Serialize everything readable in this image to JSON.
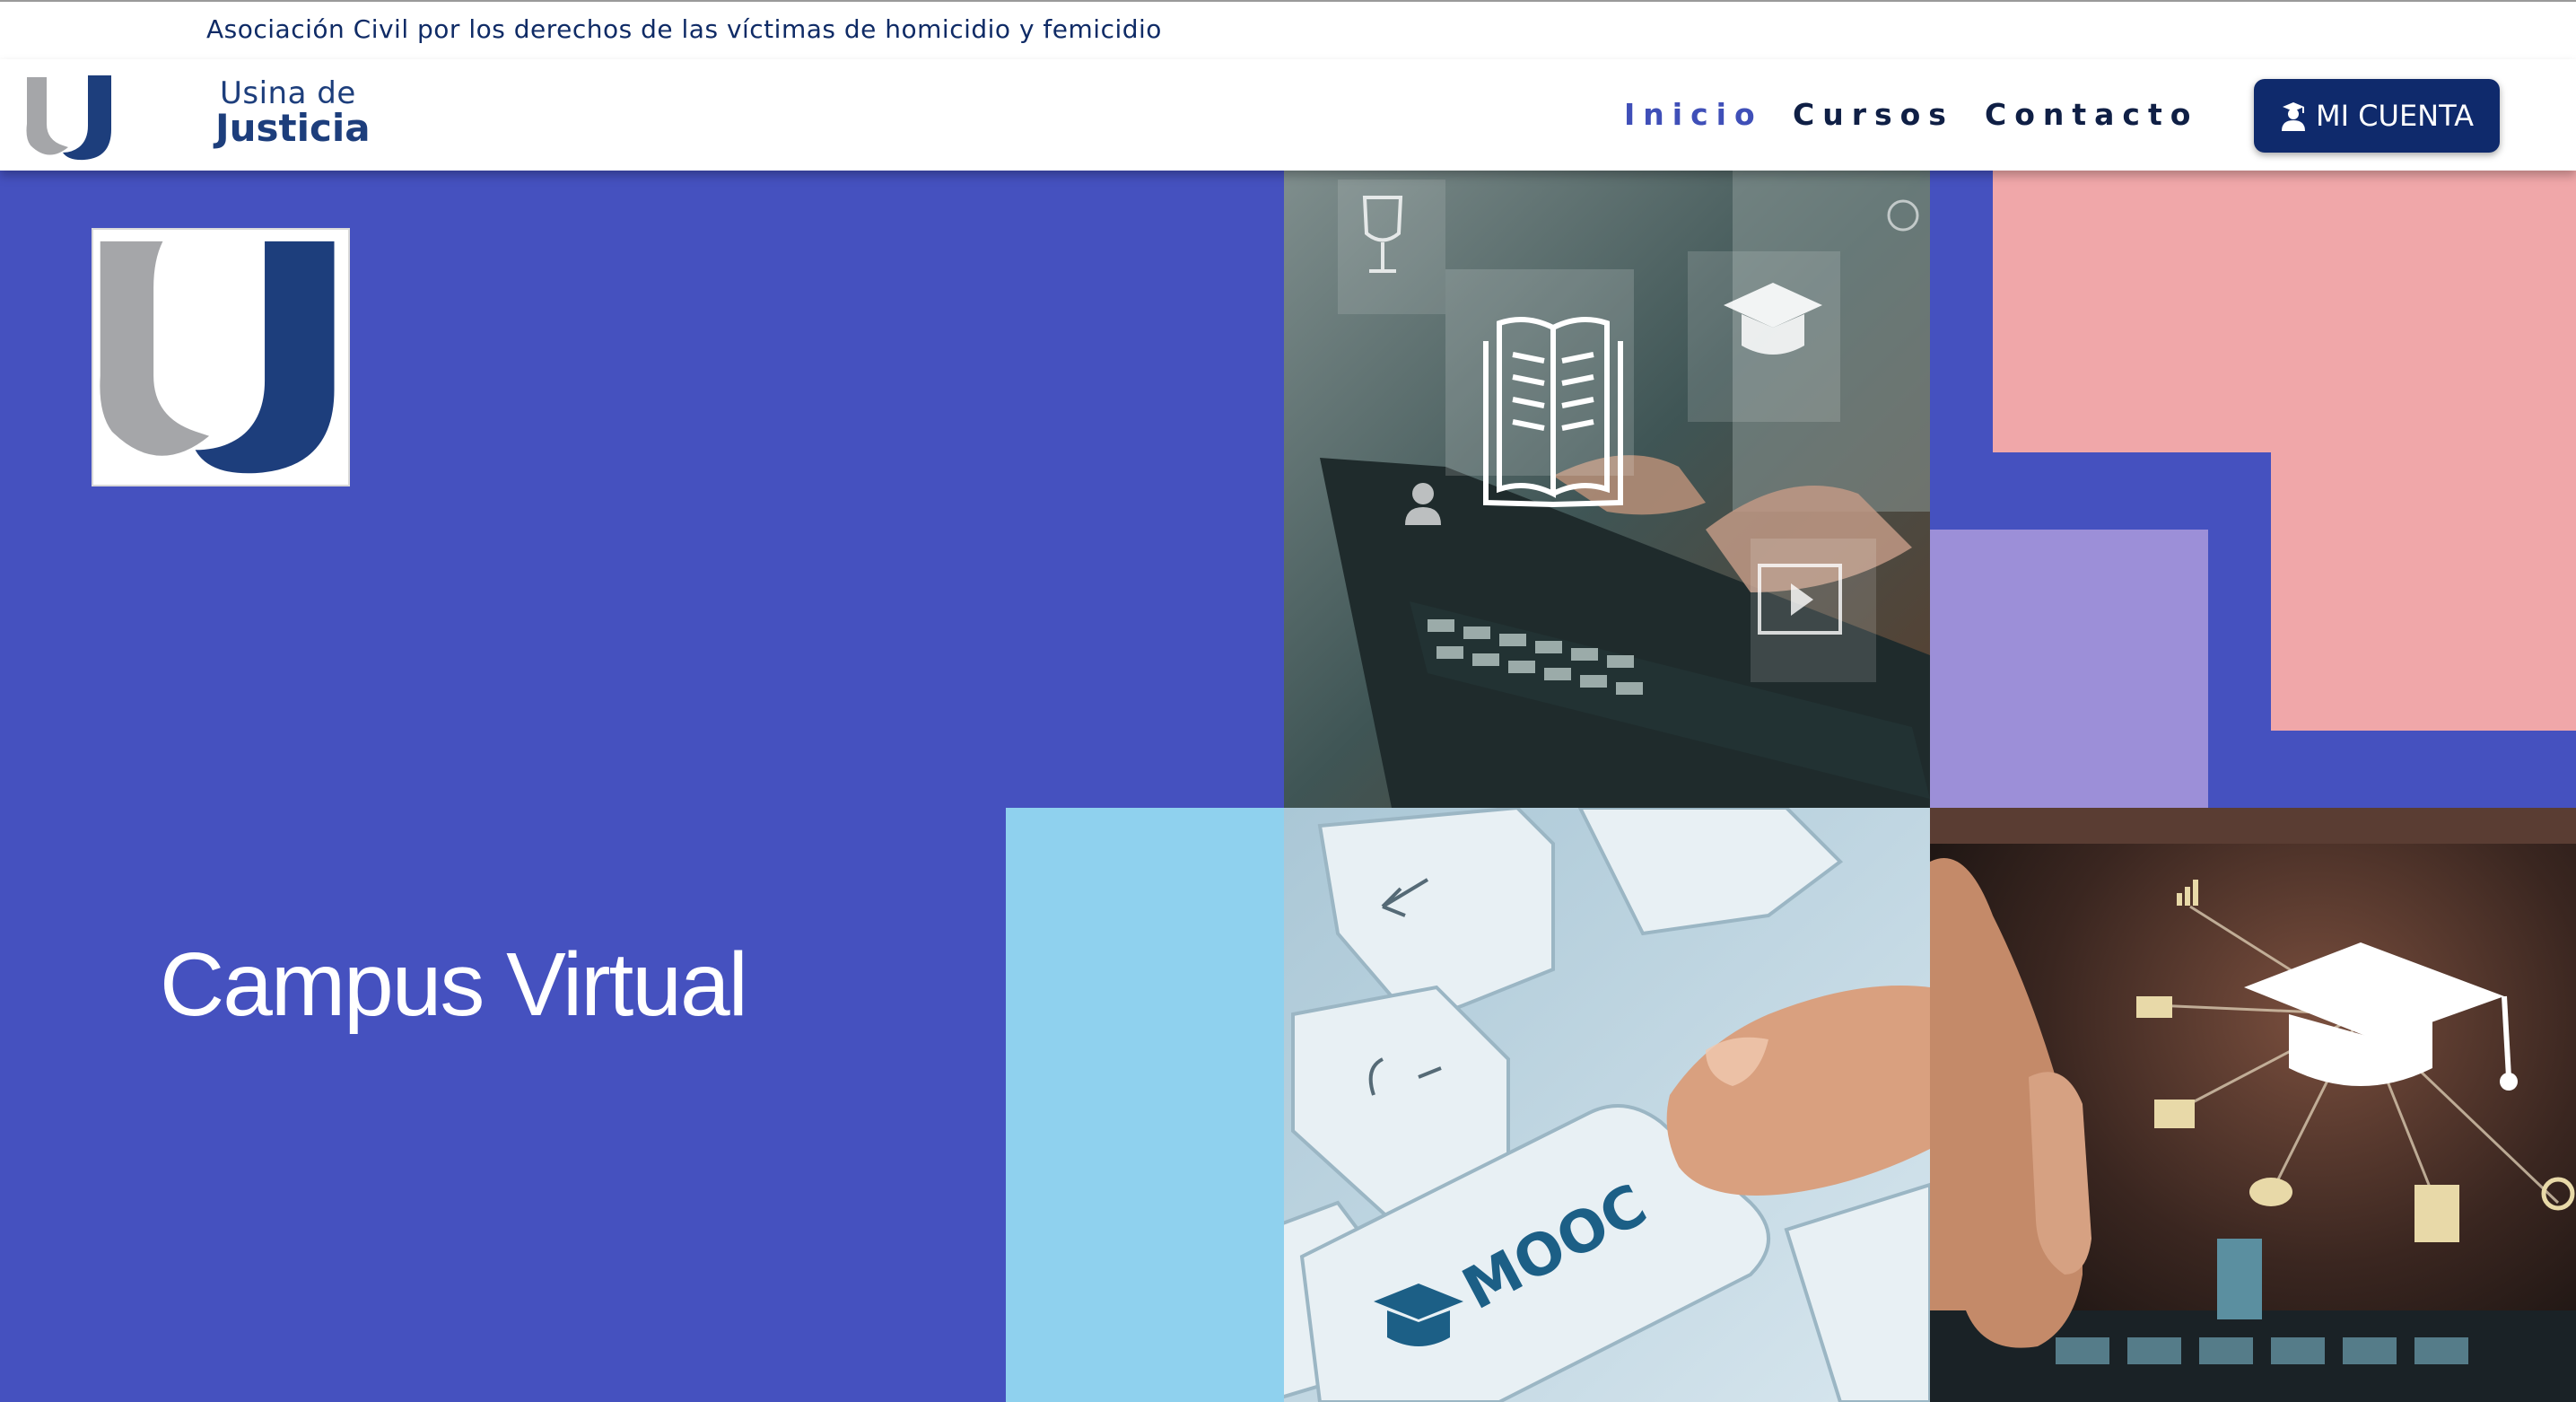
{
  "topbar": {
    "tagline": "Asociación Civil por los derechos de las víctimas de homicidio y femicidio"
  },
  "brand": {
    "line1": "Usina de",
    "line2": "Justicia"
  },
  "nav": {
    "items": [
      {
        "label": "Inicio",
        "active": true
      },
      {
        "label": "Cursos",
        "active": false
      },
      {
        "label": "Contacto",
        "active": false
      }
    ],
    "account_label": "MI CUENTA",
    "account_icon": "student-graduate-icon"
  },
  "hero": {
    "title": "Campus Virtual",
    "images": [
      {
        "name": "laptop-learning-icons-photo"
      },
      {
        "name": "mooc-keyboard-photo",
        "key_text": "MOOC"
      },
      {
        "name": "graduation-cap-network-photo"
      }
    ]
  },
  "colors": {
    "hero_bg": "#4551bf",
    "pink": "#f0a7a9",
    "lavender": "#9c8fd8",
    "light_blue": "#8fd1ee",
    "navy": "#0f2a6c",
    "logo_grey": "#a5a6a9",
    "logo_blue": "#1d3e7c"
  }
}
